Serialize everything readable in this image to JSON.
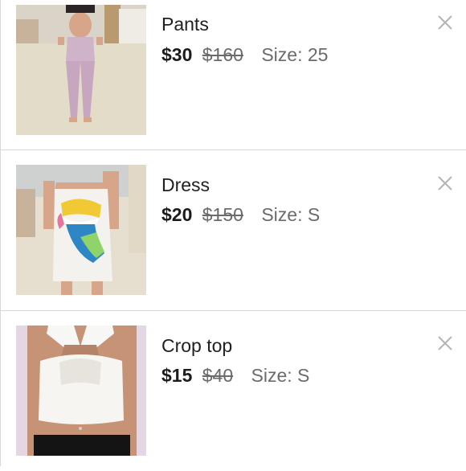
{
  "items": [
    {
      "name": "Pants",
      "price": "$30",
      "original_price": "$160",
      "size_label": "Size: 25",
      "close_icon": "close-icon"
    },
    {
      "name": "Dress",
      "price": "$20",
      "original_price": "$150",
      "size_label": "Size: S",
      "close_icon": "close-icon"
    },
    {
      "name": "Crop top",
      "price": "$15",
      "original_price": "$40",
      "size_label": "Size: S",
      "close_icon": "close-icon"
    }
  ],
  "colors": {
    "text": "#1f1f1f",
    "muted": "#6b6b6b",
    "divider": "#d6d6d6",
    "close": "#b5b5b5"
  }
}
